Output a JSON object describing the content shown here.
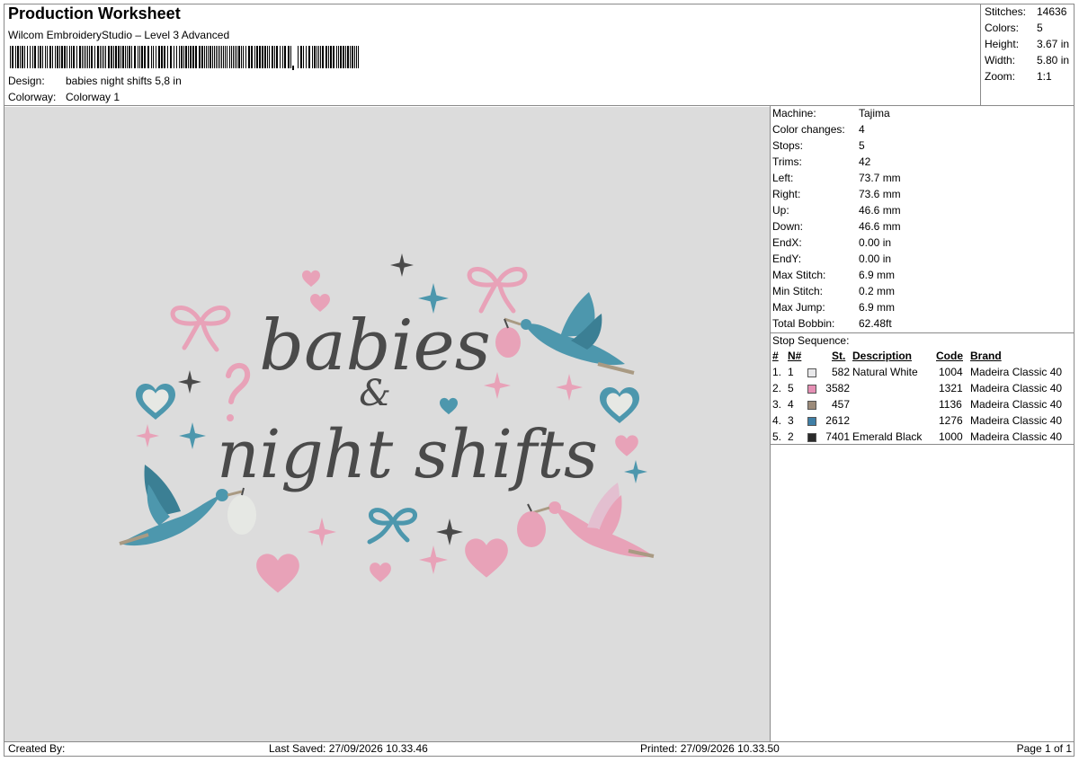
{
  "header": {
    "title": "Production Worksheet",
    "subtitle": "Wilcom EmbroideryStudio – Level 3 Advanced",
    "design_label": "Design:",
    "design_value": "babies night shifts 5,8 in",
    "colorway_label": "Colorway:",
    "colorway_value": "Colorway 1"
  },
  "summary": [
    {
      "label": "Stitches:",
      "value": "14636"
    },
    {
      "label": "Colors:",
      "value": "5"
    },
    {
      "label": "Height:",
      "value": "3.67 in"
    },
    {
      "label": "Width:",
      "value": "5.80 in"
    },
    {
      "label": "Zoom:",
      "value": "1:1"
    }
  ],
  "machine_info": [
    {
      "label": "Machine:",
      "value": "Tajima"
    },
    {
      "label": "Color changes:",
      "value": "4"
    },
    {
      "label": "Stops:",
      "value": "5"
    },
    {
      "label": "Trims:",
      "value": "42"
    },
    {
      "label": "Left:",
      "value": "73.7 mm"
    },
    {
      "label": "Right:",
      "value": "73.6 mm"
    },
    {
      "label": "Up:",
      "value": "46.6 mm"
    },
    {
      "label": "Down:",
      "value": "46.6 mm"
    },
    {
      "label": "EndX:",
      "value": "0.00 in"
    },
    {
      "label": "EndY:",
      "value": "0.00 in"
    },
    {
      "label": "Max Stitch:",
      "value": "6.9 mm"
    },
    {
      "label": "Min Stitch:",
      "value": "0.2 mm"
    },
    {
      "label": "Max Jump:",
      "value": "6.9 mm"
    },
    {
      "label": "Total Bobbin:",
      "value": "62.48ft"
    }
  ],
  "stop_sequence": {
    "title": "Stop Sequence:",
    "headers": {
      "num": "#",
      "n": "N#",
      "st": "St.",
      "description": "Description",
      "code": "Code",
      "brand": "Brand"
    },
    "rows": [
      {
        "num": "1.",
        "n": "1",
        "color": "#e8e8ea",
        "st": "582",
        "description": "Natural White",
        "code": "1004",
        "brand": "Madeira Classic 40"
      },
      {
        "num": "2.",
        "n": "5",
        "color": "#e58fb4",
        "st": "3582",
        "description": "",
        "code": "1321",
        "brand": "Madeira Classic 40"
      },
      {
        "num": "3.",
        "n": "4",
        "color": "#9c8b7a",
        "st": "457",
        "description": "",
        "code": "1136",
        "brand": "Madeira Classic 40"
      },
      {
        "num": "4.",
        "n": "3",
        "color": "#3f7fa6",
        "st": "2612",
        "description": "",
        "code": "1276",
        "brand": "Madeira Classic 40"
      },
      {
        "num": "5.",
        "n": "2",
        "color": "#2a2a2a",
        "st": "7401",
        "description": "Emerald Black",
        "code": "1000",
        "brand": "Madeira Classic 40"
      }
    ]
  },
  "design_text": {
    "line1": "babies",
    "line2": "&",
    "line3": "night shifts"
  },
  "design_colors": {
    "pink": "#e8a2b8",
    "blue": "#4d97ad",
    "black": "#4a4a4a",
    "white": "#e6e8e4",
    "tan": "#a99a83"
  },
  "footer": {
    "created_by": "Created By:",
    "last_saved": "Last Saved: 27/09/2026 10.33.46",
    "printed": "Printed: 27/09/2026 10.33.50",
    "page": "Page 1 of 1"
  }
}
